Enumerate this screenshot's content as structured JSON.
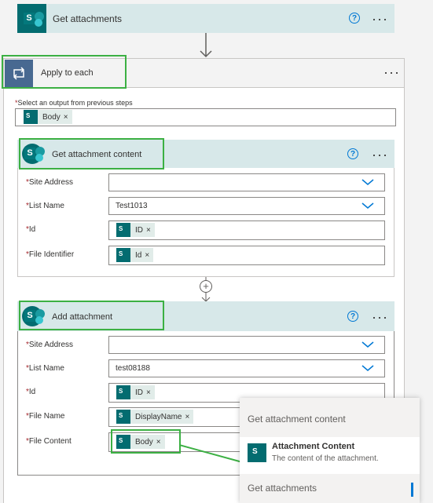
{
  "steps": {
    "get_attachments": {
      "title": "Get attachments"
    },
    "apply_to_each": {
      "title": "Apply to each",
      "output_label": "Select an output from previous steps",
      "output_token": "Body"
    },
    "get_attachment_content": {
      "title": "Get attachment content",
      "fields": [
        {
          "label": "Site Address",
          "value": ""
        },
        {
          "label": "List Name",
          "value": "Test1013"
        },
        {
          "label": "Id",
          "token": "ID"
        },
        {
          "label": "File Identifier",
          "token": "Id"
        }
      ]
    },
    "add_attachment": {
      "title": "Add attachment",
      "fields": [
        {
          "label": "Site Address",
          "value": ""
        },
        {
          "label": "List Name",
          "value": "test08188"
        },
        {
          "label": "Id",
          "token": "ID"
        },
        {
          "label": "File Name",
          "token": "DisplayName"
        },
        {
          "label": "File Content",
          "token": "Body"
        }
      ]
    }
  },
  "dynamic_panel": {
    "section_title": "Get attachment content",
    "item": {
      "title": "Attachment Content",
      "description": "The content of the attachment."
    },
    "next_section": "Get attachments"
  },
  "icons": {
    "required_marker": "*",
    "remove_token": "×",
    "help": "?",
    "more": "···",
    "add_step": "+"
  },
  "colors": {
    "sharepoint": "#036c70",
    "header_bg": "#d7e8e9",
    "apply_header": "#f3f3f3",
    "highlight": "#3cb043",
    "link": "#0078d4"
  }
}
